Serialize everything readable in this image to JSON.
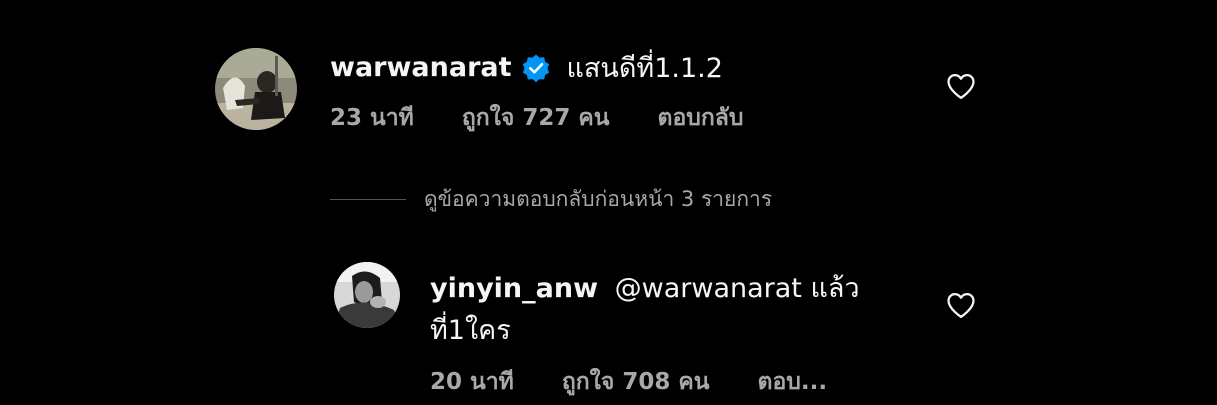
{
  "comment": {
    "username": "warwanarat",
    "verified_icon": "verified-badge-icon",
    "text": "แสนดีที่1.1.2",
    "time": "23 นาที",
    "likes": "ถูกใจ 727 คน",
    "reply_label": "ตอบกลับ",
    "heart_icon": "heart-outline-icon"
  },
  "view_replies": {
    "label": "ดูข้อความตอบกลับก่อนหน้า 3 รายการ"
  },
  "reply": {
    "username": "yinyin_anw",
    "text_line1": "@warwanarat แล้ว",
    "text_line2": "ที่1ใคร",
    "time": "20 นาที",
    "likes": "ถูกใจ 708 คน",
    "reply_label": "ตอบ...",
    "heart_icon": "heart-outline-icon"
  },
  "colors": {
    "background": "#000000",
    "primary_text": "#f5f5f5",
    "secondary_text": "#a8a8a8",
    "verified_blue": "#0095f6"
  }
}
